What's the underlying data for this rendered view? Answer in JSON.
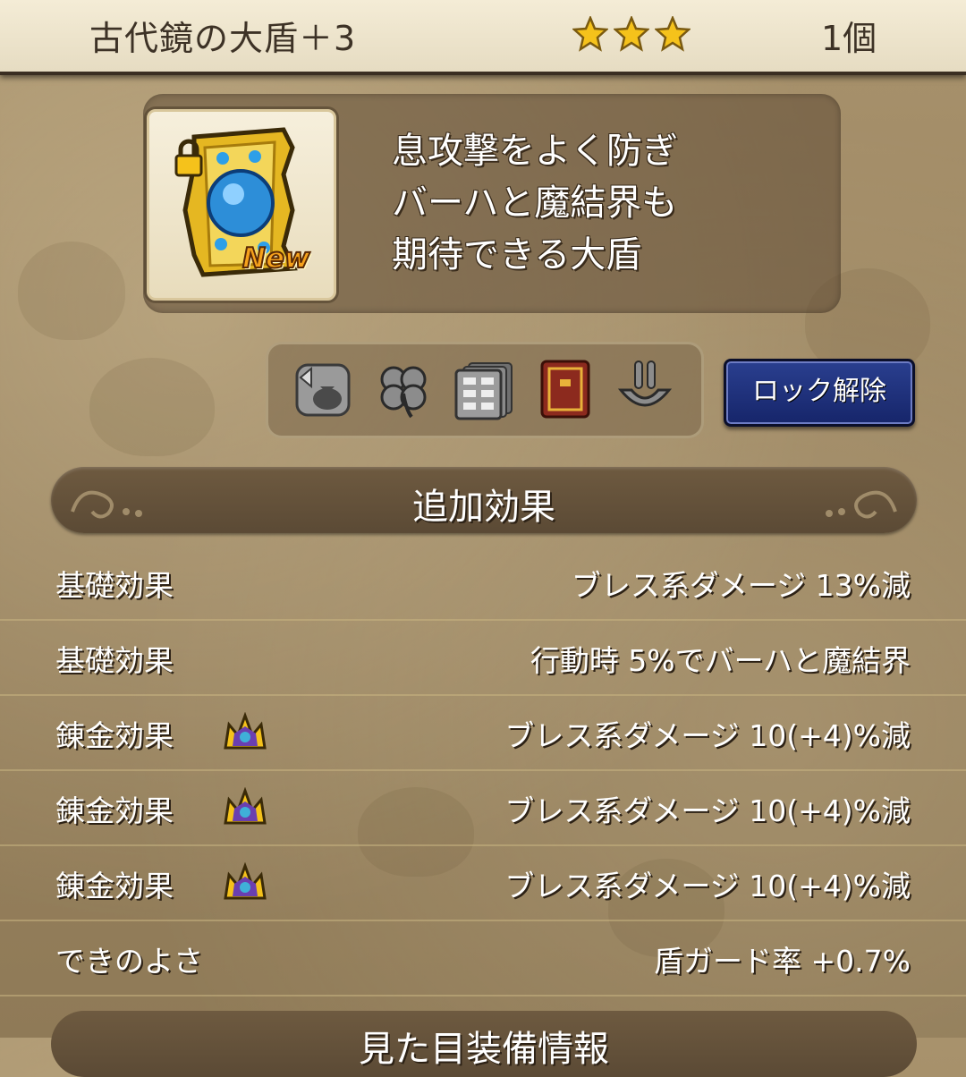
{
  "header": {
    "item_name": "古代鏡の大盾＋3",
    "rarity_stars": 3,
    "quantity": "1個"
  },
  "item": {
    "icon": "golden-shield-icon",
    "badge": "New",
    "locked": true,
    "description": [
      "息攻撃をよく防ぎ",
      "バーハと魔結界も",
      "期待できる大盾"
    ]
  },
  "actions": {
    "icons": [
      "sell-bag-icon",
      "clover-icon",
      "storage-icon",
      "book-icon",
      "tongs-icon"
    ],
    "unlock_label": "ロック解除"
  },
  "section": {
    "title": "追加効果",
    "next_title": "見た目装備情報"
  },
  "effects": [
    {
      "label": "基礎効果",
      "value": "ブレス系ダメージ  13%減",
      "crown": false
    },
    {
      "label": "基礎効果",
      "value": "行動時  5%でバーハと魔結界",
      "crown": false
    },
    {
      "label": "錬金効果",
      "value": "ブレス系ダメージ  10(+4)%減",
      "crown": true
    },
    {
      "label": "錬金効果",
      "value": "ブレス系ダメージ  10(+4)%減",
      "crown": true
    },
    {
      "label": "錬金効果",
      "value": "ブレス系ダメージ  10(+4)%減",
      "crown": true
    },
    {
      "label": "できのよさ",
      "value": "盾ガード率  +0.7%",
      "crown": false
    }
  ],
  "colors": {
    "header_bg": "#f4ecd6",
    "panel_brown": "#5b4a35",
    "button_blue": "#1f3280",
    "star_gold": "#f5c21b"
  }
}
